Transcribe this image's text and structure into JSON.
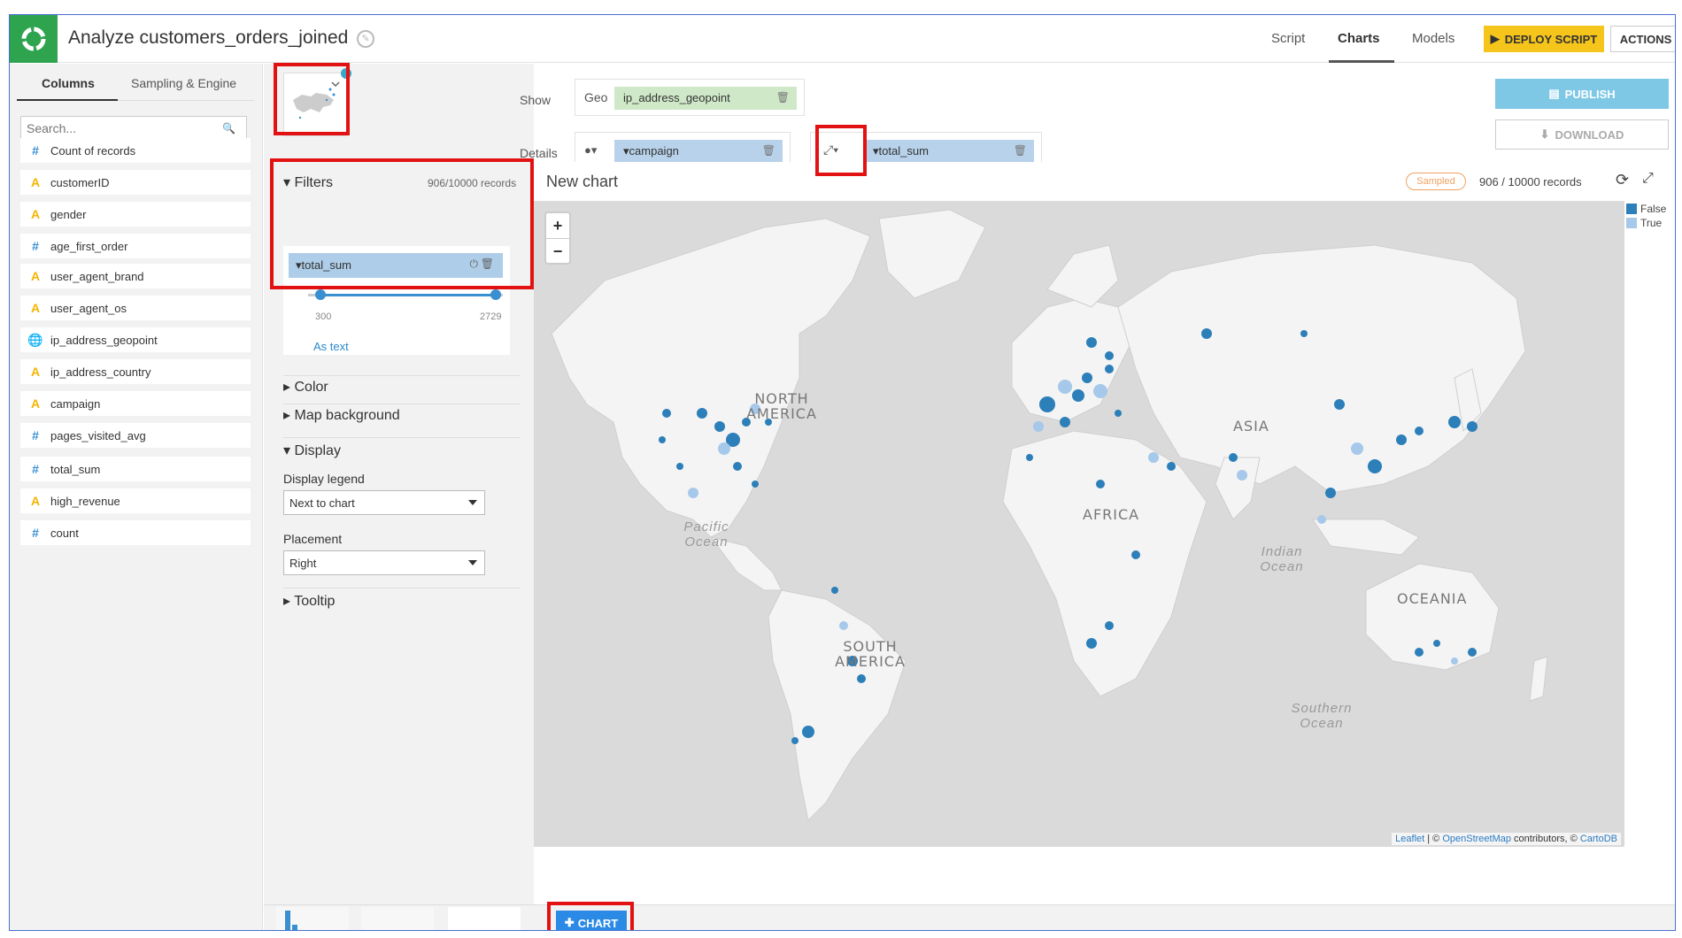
{
  "header": {
    "title": "Analyze customers_orders_joined",
    "tabs": [
      "Script",
      "Charts",
      "Models"
    ],
    "deploy_label": "DEPLOY SCRIPT",
    "actions_label": "ACTIONS"
  },
  "left_panel": {
    "tabs": [
      "Columns",
      "Sampling & Engine"
    ],
    "search_placeholder": "Search...",
    "columns": [
      {
        "type": "#",
        "name": "Count of records"
      },
      {
        "type": "A",
        "name": "customerID"
      },
      {
        "type": "A",
        "name": "gender"
      },
      {
        "type": "#",
        "name": "age_first_order"
      },
      {
        "type": "A",
        "name": "user_agent_brand"
      },
      {
        "type": "A",
        "name": "user_agent_os"
      },
      {
        "type": "geo",
        "name": "ip_address_geopoint"
      },
      {
        "type": "A",
        "name": "ip_address_country"
      },
      {
        "type": "A",
        "name": "campaign"
      },
      {
        "type": "#",
        "name": "pages_visited_avg"
      },
      {
        "type": "#",
        "name": "total_sum"
      },
      {
        "type": "A",
        "name": "high_revenue"
      },
      {
        "type": "#",
        "name": "count"
      }
    ]
  },
  "controls": {
    "show_label": "Show",
    "geo_label": "Geo",
    "geo_field": "ip_address_geopoint",
    "details_label": "Details",
    "color_field": "campaign",
    "size_field": "total_sum",
    "publish_label": "PUBLISH",
    "download_label": "DOWNLOAD"
  },
  "filters": {
    "title": "Filters",
    "records": "906/10000 records",
    "field": "total_sum",
    "min": "300",
    "max": "2729",
    "as_text": "As text"
  },
  "sections": {
    "color": "Color",
    "map_background": "Map background",
    "display": "Display",
    "display_legend_label": "Display legend",
    "display_legend_value": "Next to chart",
    "placement_label": "Placement",
    "placement_value": "Right",
    "tooltip": "Tooltip"
  },
  "chart": {
    "title": "New chart",
    "sampled": "Sampled",
    "records": "906 / 10000 records",
    "legend": [
      {
        "label": "False",
        "color": "#2c7fb8"
      },
      {
        "label": "True",
        "color": "#a6c8ea"
      }
    ],
    "zoom_in": "+",
    "zoom_out": "−",
    "map_labels": {
      "north_america": "NORTH AMERICA",
      "south_america": "SOUTH AMERICA",
      "asia": "ASIA",
      "africa": "AFRICA",
      "oceania": "OCEANIA",
      "pacific": "Pacific Ocean",
      "indian": "Indian Ocean",
      "southern": "Southern Ocean"
    },
    "attribution": {
      "leaflet": "Leaflet",
      "osm": "OpenStreetMap",
      "contributors": "contributors, ©",
      "carto": "CartoDB"
    }
  },
  "bottom": {
    "add_chart_label": "CHART"
  }
}
